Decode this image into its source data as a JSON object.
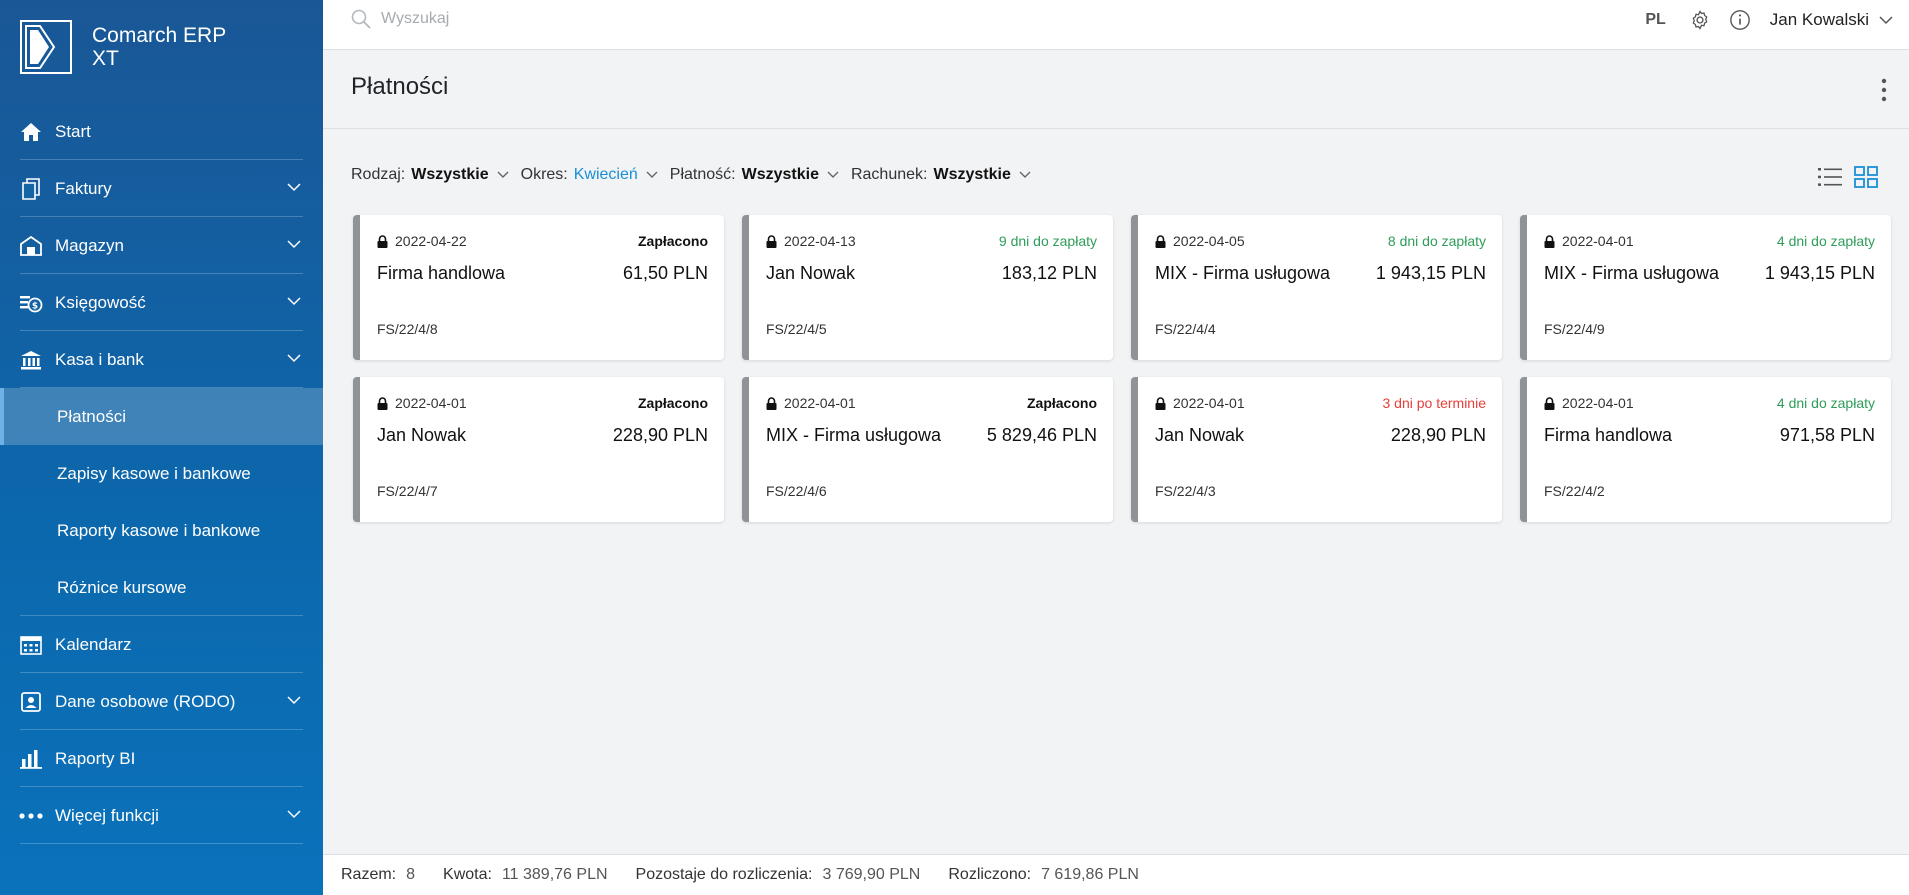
{
  "app": {
    "name_line1": "Comarch ERP",
    "name_line2": "XT"
  },
  "topbar": {
    "search_placeholder": "Wyszukaj",
    "lang": "PL",
    "user": "Jan Kowalski"
  },
  "sidebar": {
    "items": [
      {
        "label": "Start",
        "icon": "home-icon",
        "expandable": false
      },
      {
        "label": "Faktury",
        "icon": "invoice-icon",
        "expandable": true
      },
      {
        "label": "Magazyn",
        "icon": "warehouse-icon",
        "expandable": true
      },
      {
        "label": "Księgowość",
        "icon": "accounting-icon",
        "expandable": true
      },
      {
        "label": "Kasa i bank",
        "icon": "bank-icon",
        "expandable": true
      }
    ],
    "sub_items": [
      {
        "label": "Płatności",
        "active": true
      },
      {
        "label": "Zapisy kasowe i bankowe",
        "active": false
      },
      {
        "label": "Raporty kasowe i bankowe",
        "active": false
      },
      {
        "label": "Różnice kursowe",
        "active": false
      }
    ],
    "items_after": [
      {
        "label": "Kalendarz",
        "icon": "calendar-icon",
        "expandable": false
      },
      {
        "label": "Dane osobowe (RODO)",
        "icon": "person-card-icon",
        "expandable": true
      },
      {
        "label": "Raporty BI",
        "icon": "bar-chart-icon",
        "expandable": false
      },
      {
        "label": "Więcej funkcji",
        "icon": "more-dots-icon",
        "expandable": true
      }
    ]
  },
  "page": {
    "title": "Płatności"
  },
  "filters": [
    {
      "label": "Rodzaj:",
      "value": "Wszystkie",
      "accent": false
    },
    {
      "label": "Okres:",
      "value": "Kwiecień",
      "accent": true
    },
    {
      "label": "Płatność:",
      "value": "Wszystkie",
      "accent": false
    },
    {
      "label": "Rachunek:",
      "value": "Wszystkie",
      "accent": false
    }
  ],
  "cards": [
    {
      "date": "2022-04-22",
      "status": "Zapłacono",
      "status_type": "paid",
      "name": "Firma handlowa",
      "amount": "61,50 PLN",
      "doc": "FS/22/4/8"
    },
    {
      "date": "2022-04-13",
      "status": "9 dni do zapłaty",
      "status_type": "ok",
      "name": "Jan Nowak",
      "amount": "183,12 PLN",
      "doc": "FS/22/4/5"
    },
    {
      "date": "2022-04-05",
      "status": "8 dni do zapłaty",
      "status_type": "ok",
      "name": "MIX - Firma usługowa",
      "amount": "1 943,15 PLN",
      "doc": "FS/22/4/4"
    },
    {
      "date": "2022-04-01",
      "status": "4 dni do zapłaty",
      "status_type": "ok",
      "name": "MIX - Firma usługowa",
      "amount": "1 943,15 PLN",
      "doc": "FS/22/4/9"
    },
    {
      "date": "2022-04-01",
      "status": "Zapłacono",
      "status_type": "paid",
      "name": "Jan Nowak",
      "amount": "228,90 PLN",
      "doc": "FS/22/4/7"
    },
    {
      "date": "2022-04-01",
      "status": "Zapłacono",
      "status_type": "paid",
      "name": "MIX - Firma usługowa",
      "amount": "5 829,46 PLN",
      "doc": "FS/22/4/6"
    },
    {
      "date": "2022-04-01",
      "status": "3 dni po terminie",
      "status_type": "late",
      "name": "Jan Nowak",
      "amount": "228,90 PLN",
      "doc": "FS/22/4/3"
    },
    {
      "date": "2022-04-01",
      "status": "4 dni do zapłaty",
      "status_type": "ok",
      "name": "Firma handlowa",
      "amount": "971,58 PLN",
      "doc": "FS/22/4/2"
    }
  ],
  "footer": {
    "total_label": "Razem:",
    "total_value": "8",
    "amount_label": "Kwota:",
    "amount_value": "11 389,76 PLN",
    "remaining_label": "Pozostaje do rozliczenia:",
    "remaining_value": "3 769,90 PLN",
    "settled_label": "Rozliczono:",
    "settled_value": "7 619,86 PLN"
  },
  "colors": {
    "sidebar_top": "#1a5796",
    "sidebar_bottom": "#0a72bb",
    "accent": "#1a8fd6",
    "ok": "#2e9d5a",
    "late": "#e5403a"
  }
}
